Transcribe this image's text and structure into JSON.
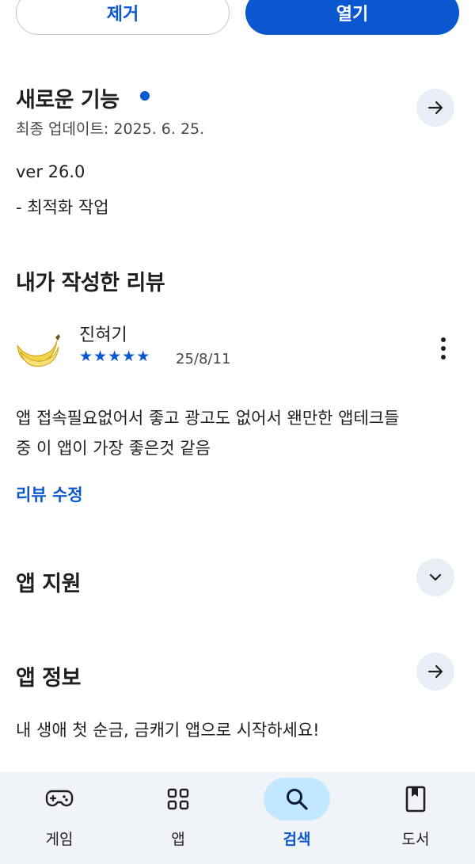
{
  "actions": {
    "remove_label": "제거",
    "open_label": "열기"
  },
  "whats_new": {
    "title": "새로운 기능",
    "updated": "최종 업데이트: 2025. 6. 25.",
    "version": "ver 26.0",
    "note": "- 최적화 작업"
  },
  "my_review": {
    "title": "내가 작성한 리뷰",
    "author": "진혀기",
    "rating": 5,
    "date": "25/8/11",
    "text_line1": "앱 접속필요없어서 좋고 광고도 없어서 왠만한 앱테크들",
    "text_line2": "중 이 앱이 가장 좋은것 같음",
    "edit_label": "리뷰 수정"
  },
  "app_support": {
    "title": "앱 지원"
  },
  "app_info": {
    "title": "앱 정보",
    "description": "내 생애 첫 순금, 금캐기 앱으로 시작하세요!"
  },
  "nav": {
    "items": [
      {
        "label": "게임",
        "icon": "gamepad-icon"
      },
      {
        "label": "앱",
        "icon": "apps-grid-icon"
      },
      {
        "label": "검색",
        "icon": "search-icon",
        "active": true
      },
      {
        "label": "도서",
        "icon": "book-icon"
      }
    ]
  },
  "colors": {
    "accent": "#0b57d0",
    "chip_bg": "#e9eef6",
    "nav_bg": "#f0f4f9",
    "nav_active_bg": "#c2e7ff"
  }
}
